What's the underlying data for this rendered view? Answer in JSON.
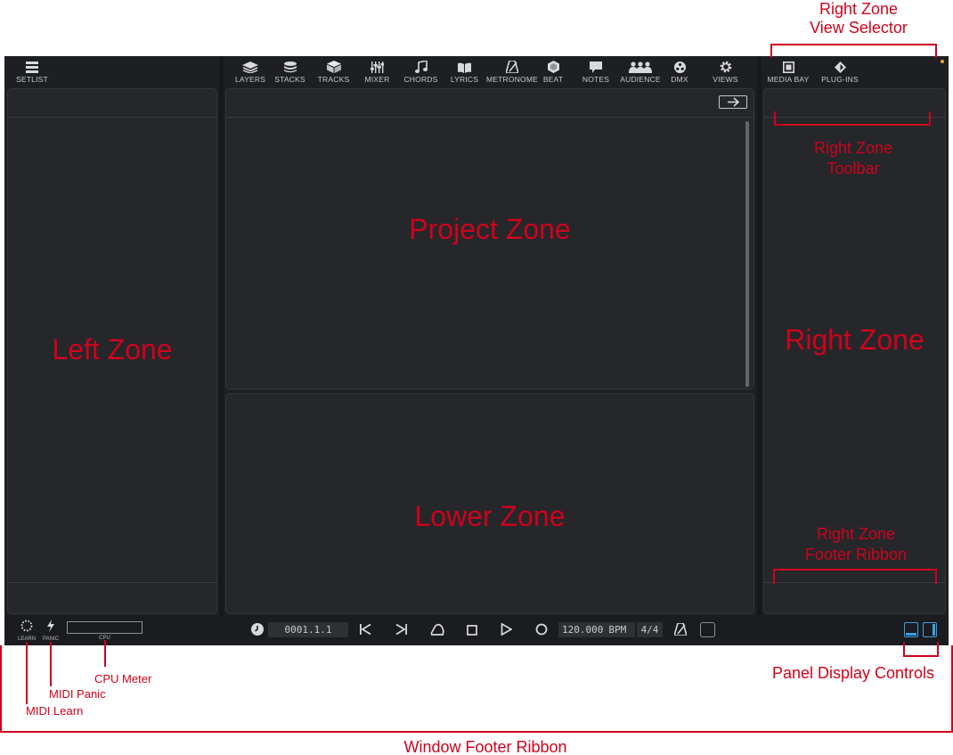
{
  "left_tabs": [
    {
      "label": "SETLIST",
      "icon": "setlist-icon"
    }
  ],
  "center_tabs": [
    {
      "label": "LAYERS",
      "icon": "layers-icon"
    },
    {
      "label": "STACKS",
      "icon": "stacks-icon"
    },
    {
      "label": "TRACKS",
      "icon": "tracks-icon"
    },
    {
      "label": "MIXER",
      "icon": "mixer-icon"
    },
    {
      "label": "CHORDS",
      "icon": "chords-icon"
    },
    {
      "label": "LYRICS",
      "icon": "lyrics-icon"
    },
    {
      "label": "METRONOME",
      "icon": "metronome-icon"
    },
    {
      "label": "BEAT",
      "icon": "beat-icon"
    },
    {
      "label": "NOTES",
      "icon": "notes-icon"
    },
    {
      "label": "AUDIENCE",
      "icon": "audience-icon"
    },
    {
      "label": "DMX",
      "icon": "dmx-icon"
    },
    {
      "label": "VIEWS",
      "icon": "views-icon"
    }
  ],
  "right_tabs": [
    {
      "label": "MEDIA BAY",
      "icon": "media-bay-icon"
    },
    {
      "label": "PLUG-INS",
      "icon": "plug-ins-icon"
    }
  ],
  "zones": {
    "left": "Left Zone",
    "project": "Project Zone",
    "lower": "Lower Zone",
    "right": "Right Zone"
  },
  "annotations": {
    "right_zone_view_selector": [
      "Right Zone",
      "View Selector"
    ],
    "right_zone_toolbar": [
      "Right Zone",
      "Toolbar"
    ],
    "right_zone_footer_ribbon": [
      "Right Zone",
      "Footer Ribbon"
    ],
    "cpu_meter": "CPU Meter",
    "midi_panic": "MIDI Panic",
    "midi_learn": "MIDI Learn",
    "panel_display_controls": "Panel Display Controls",
    "window_footer_ribbon": "Window Footer Ribbon"
  },
  "footer": {
    "learn_label": "LEARN",
    "panic_label": "PANIC",
    "cpu_label": "CPU",
    "cpu_level": 0,
    "position": "0001.1.1",
    "tempo": "120.000",
    "tempo_unit": "BPM",
    "signature": "4/4"
  },
  "colors": {
    "annotation": "#d0021b",
    "app_background": "#17181a",
    "zone_background": "#25272b",
    "active_indicator": "#e8a33d",
    "panel_control_active": "#3b9fe8"
  }
}
